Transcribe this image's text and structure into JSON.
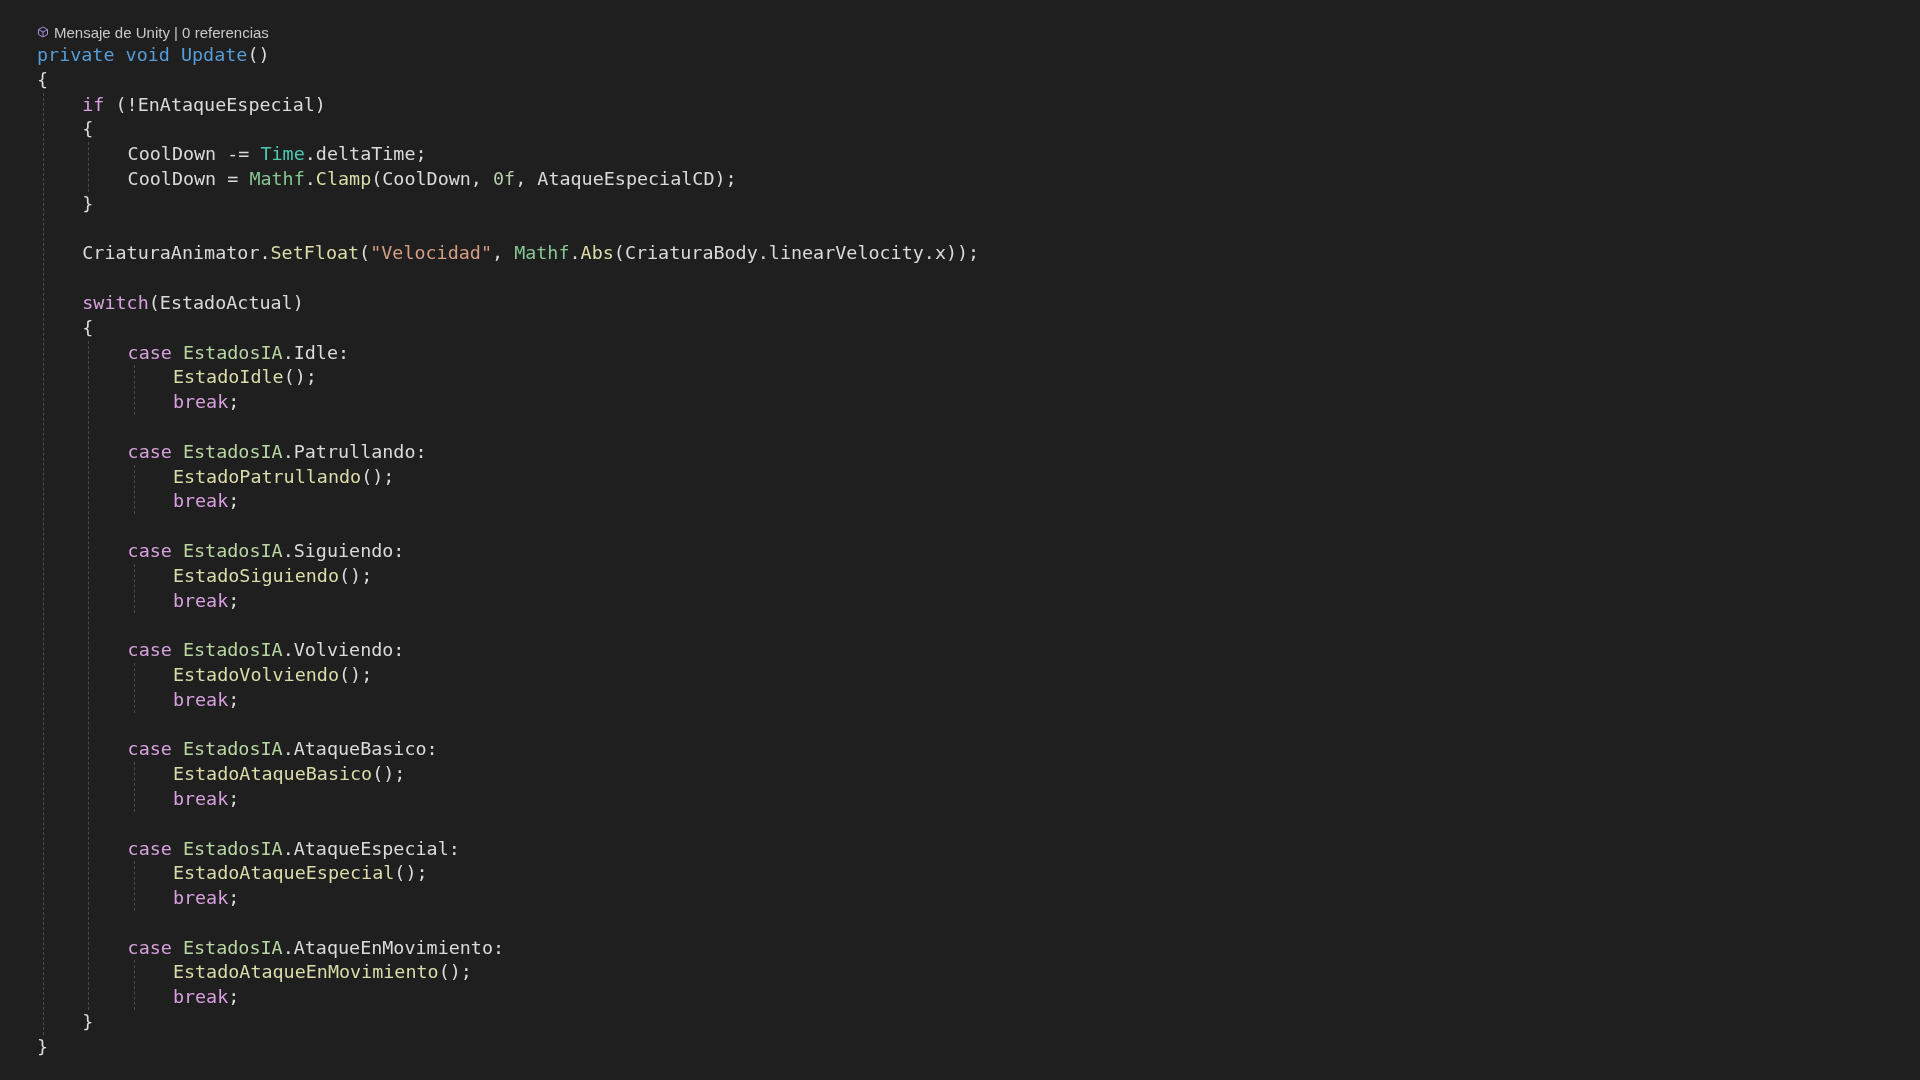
{
  "codelens": {
    "text": "Mensaje de Unity | 0 referencias"
  },
  "lines": [
    {
      "kind": "code",
      "tokens": [
        {
          "kind": "keyword",
          "text": "private void Update"
        },
        {
          "kind": "plain",
          "text": "()"
        }
      ]
    },
    {
      "kind": "code",
      "tokens": [
        {
          "kind": "plain",
          "text": "{"
        }
      ],
      "children": [
        {
          "kind": "code",
          "tokens": [
            {
              "kind": "control",
              "text": "if"
            },
            {
              "kind": "plain",
              "text": " (!EnAtaqueEspecial)"
            }
          ]
        },
        {
          "kind": "code",
          "tokens": [
            {
              "kind": "plain",
              "text": "{"
            }
          ],
          "children": [
            {
              "kind": "code",
              "tokens": [
                {
                  "kind": "plain",
                  "text": "CoolDown -= "
                },
                {
                  "kind": "class",
                  "text": "Time"
                },
                {
                  "kind": "plain",
                  "text": ".deltaTime;"
                }
              ]
            },
            {
              "kind": "code",
              "tokens": [
                {
                  "kind": "plain",
                  "text": "CoolDown = "
                },
                {
                  "kind": "struct",
                  "text": "Mathf"
                },
                {
                  "kind": "plain",
                  "text": "."
                },
                {
                  "kind": "method",
                  "text": "Clamp"
                },
                {
                  "kind": "plain",
                  "text": "(CoolDown, "
                },
                {
                  "kind": "number",
                  "text": "0f"
                },
                {
                  "kind": "plain",
                  "text": ", AtaqueEspecialCD);"
                }
              ]
            }
          ]
        },
        {
          "kind": "code",
          "tokens": [
            {
              "kind": "plain",
              "text": "}"
            }
          ]
        },
        {
          "kind": "blank"
        },
        {
          "kind": "code",
          "tokens": [
            {
              "kind": "plain",
              "text": "CriaturaAnimator."
            },
            {
              "kind": "method",
              "text": "SetFloat"
            },
            {
              "kind": "plain",
              "text": "("
            },
            {
              "kind": "string",
              "text": "\"Velocidad\""
            },
            {
              "kind": "plain",
              "text": ", "
            },
            {
              "kind": "struct",
              "text": "Mathf"
            },
            {
              "kind": "plain",
              "text": "."
            },
            {
              "kind": "method",
              "text": "Abs"
            },
            {
              "kind": "plain",
              "text": "(CriaturaBody.linearVelocity.x));"
            }
          ]
        },
        {
          "kind": "blank"
        },
        {
          "kind": "code",
          "tokens": [
            {
              "kind": "control",
              "text": "switch"
            },
            {
              "kind": "plain",
              "text": "(EstadoActual)"
            }
          ]
        },
        {
          "kind": "code",
          "tokens": [
            {
              "kind": "plain",
              "text": "{"
            }
          ],
          "children": [
            {
              "kind": "code",
              "tokens": [
                {
                  "kind": "control",
                  "text": "case "
                },
                {
                  "kind": "enum",
                  "text": "EstadosIA"
                },
                {
                  "kind": "plain",
                  "text": ".Idle:"
                }
              ],
              "children": [
                {
                  "kind": "code",
                  "tokens": [
                    {
                      "kind": "method",
                      "text": "EstadoIdle"
                    },
                    {
                      "kind": "plain",
                      "text": "();"
                    }
                  ]
                },
                {
                  "kind": "code",
                  "tokens": [
                    {
                      "kind": "control",
                      "text": "break"
                    },
                    {
                      "kind": "plain",
                      "text": ";"
                    }
                  ]
                }
              ]
            },
            {
              "kind": "blank"
            },
            {
              "kind": "code",
              "tokens": [
                {
                  "kind": "control",
                  "text": "case "
                },
                {
                  "kind": "enum",
                  "text": "EstadosIA"
                },
                {
                  "kind": "plain",
                  "text": ".Patrullando:"
                }
              ],
              "children": [
                {
                  "kind": "code",
                  "tokens": [
                    {
                      "kind": "method",
                      "text": "EstadoPatrullando"
                    },
                    {
                      "kind": "plain",
                      "text": "();"
                    }
                  ]
                },
                {
                  "kind": "code",
                  "tokens": [
                    {
                      "kind": "control",
                      "text": "break"
                    },
                    {
                      "kind": "plain",
                      "text": ";"
                    }
                  ]
                }
              ]
            },
            {
              "kind": "blank"
            },
            {
              "kind": "code",
              "tokens": [
                {
                  "kind": "control",
                  "text": "case "
                },
                {
                  "kind": "enum",
                  "text": "EstadosIA"
                },
                {
                  "kind": "plain",
                  "text": ".Siguiendo:"
                }
              ],
              "children": [
                {
                  "kind": "code",
                  "tokens": [
                    {
                      "kind": "method",
                      "text": "EstadoSiguiendo"
                    },
                    {
                      "kind": "plain",
                      "text": "();"
                    }
                  ]
                },
                {
                  "kind": "code",
                  "tokens": [
                    {
                      "kind": "control",
                      "text": "break"
                    },
                    {
                      "kind": "plain",
                      "text": ";"
                    }
                  ]
                }
              ]
            },
            {
              "kind": "blank"
            },
            {
              "kind": "code",
              "tokens": [
                {
                  "kind": "control",
                  "text": "case "
                },
                {
                  "kind": "enum",
                  "text": "EstadosIA"
                },
                {
                  "kind": "plain",
                  "text": ".Volviendo:"
                }
              ],
              "children": [
                {
                  "kind": "code",
                  "tokens": [
                    {
                      "kind": "method",
                      "text": "EstadoVolviendo"
                    },
                    {
                      "kind": "plain",
                      "text": "();"
                    }
                  ]
                },
                {
                  "kind": "code",
                  "tokens": [
                    {
                      "kind": "control",
                      "text": "break"
                    },
                    {
                      "kind": "plain",
                      "text": ";"
                    }
                  ]
                }
              ]
            },
            {
              "kind": "blank"
            },
            {
              "kind": "code",
              "tokens": [
                {
                  "kind": "control",
                  "text": "case "
                },
                {
                  "kind": "enum",
                  "text": "EstadosIA"
                },
                {
                  "kind": "plain",
                  "text": ".AtaqueBasico:"
                }
              ],
              "children": [
                {
                  "kind": "code",
                  "tokens": [
                    {
                      "kind": "method",
                      "text": "EstadoAtaqueBasico"
                    },
                    {
                      "kind": "plain",
                      "text": "();"
                    }
                  ]
                },
                {
                  "kind": "code",
                  "tokens": [
                    {
                      "kind": "control",
                      "text": "break"
                    },
                    {
                      "kind": "plain",
                      "text": ";"
                    }
                  ]
                }
              ]
            },
            {
              "kind": "blank"
            },
            {
              "kind": "code",
              "tokens": [
                {
                  "kind": "control",
                  "text": "case "
                },
                {
                  "kind": "enum",
                  "text": "EstadosIA"
                },
                {
                  "kind": "plain",
                  "text": ".AtaqueEspecial:"
                }
              ],
              "children": [
                {
                  "kind": "code",
                  "tokens": [
                    {
                      "kind": "method",
                      "text": "EstadoAtaqueEspecial"
                    },
                    {
                      "kind": "plain",
                      "text": "();"
                    }
                  ]
                },
                {
                  "kind": "code",
                  "tokens": [
                    {
                      "kind": "control",
                      "text": "break"
                    },
                    {
                      "kind": "plain",
                      "text": ";"
                    }
                  ]
                }
              ]
            },
            {
              "kind": "blank"
            },
            {
              "kind": "code",
              "tokens": [
                {
                  "kind": "control",
                  "text": "case "
                },
                {
                  "kind": "enum",
                  "text": "EstadosIA"
                },
                {
                  "kind": "plain",
                  "text": ".AtaqueEnMovimiento:"
                }
              ],
              "children": [
                {
                  "kind": "code",
                  "tokens": [
                    {
                      "kind": "method",
                      "text": "EstadoAtaqueEnMovimiento"
                    },
                    {
                      "kind": "plain",
                      "text": "();"
                    }
                  ]
                },
                {
                  "kind": "code",
                  "tokens": [
                    {
                      "kind": "control",
                      "text": "break"
                    },
                    {
                      "kind": "plain",
                      "text": ";"
                    }
                  ]
                }
              ]
            }
          ]
        },
        {
          "kind": "code",
          "tokens": [
            {
              "kind": "plain",
              "text": "}"
            }
          ]
        }
      ]
    },
    {
      "kind": "code",
      "tokens": [
        {
          "kind": "plain",
          "text": "}"
        }
      ]
    }
  ]
}
